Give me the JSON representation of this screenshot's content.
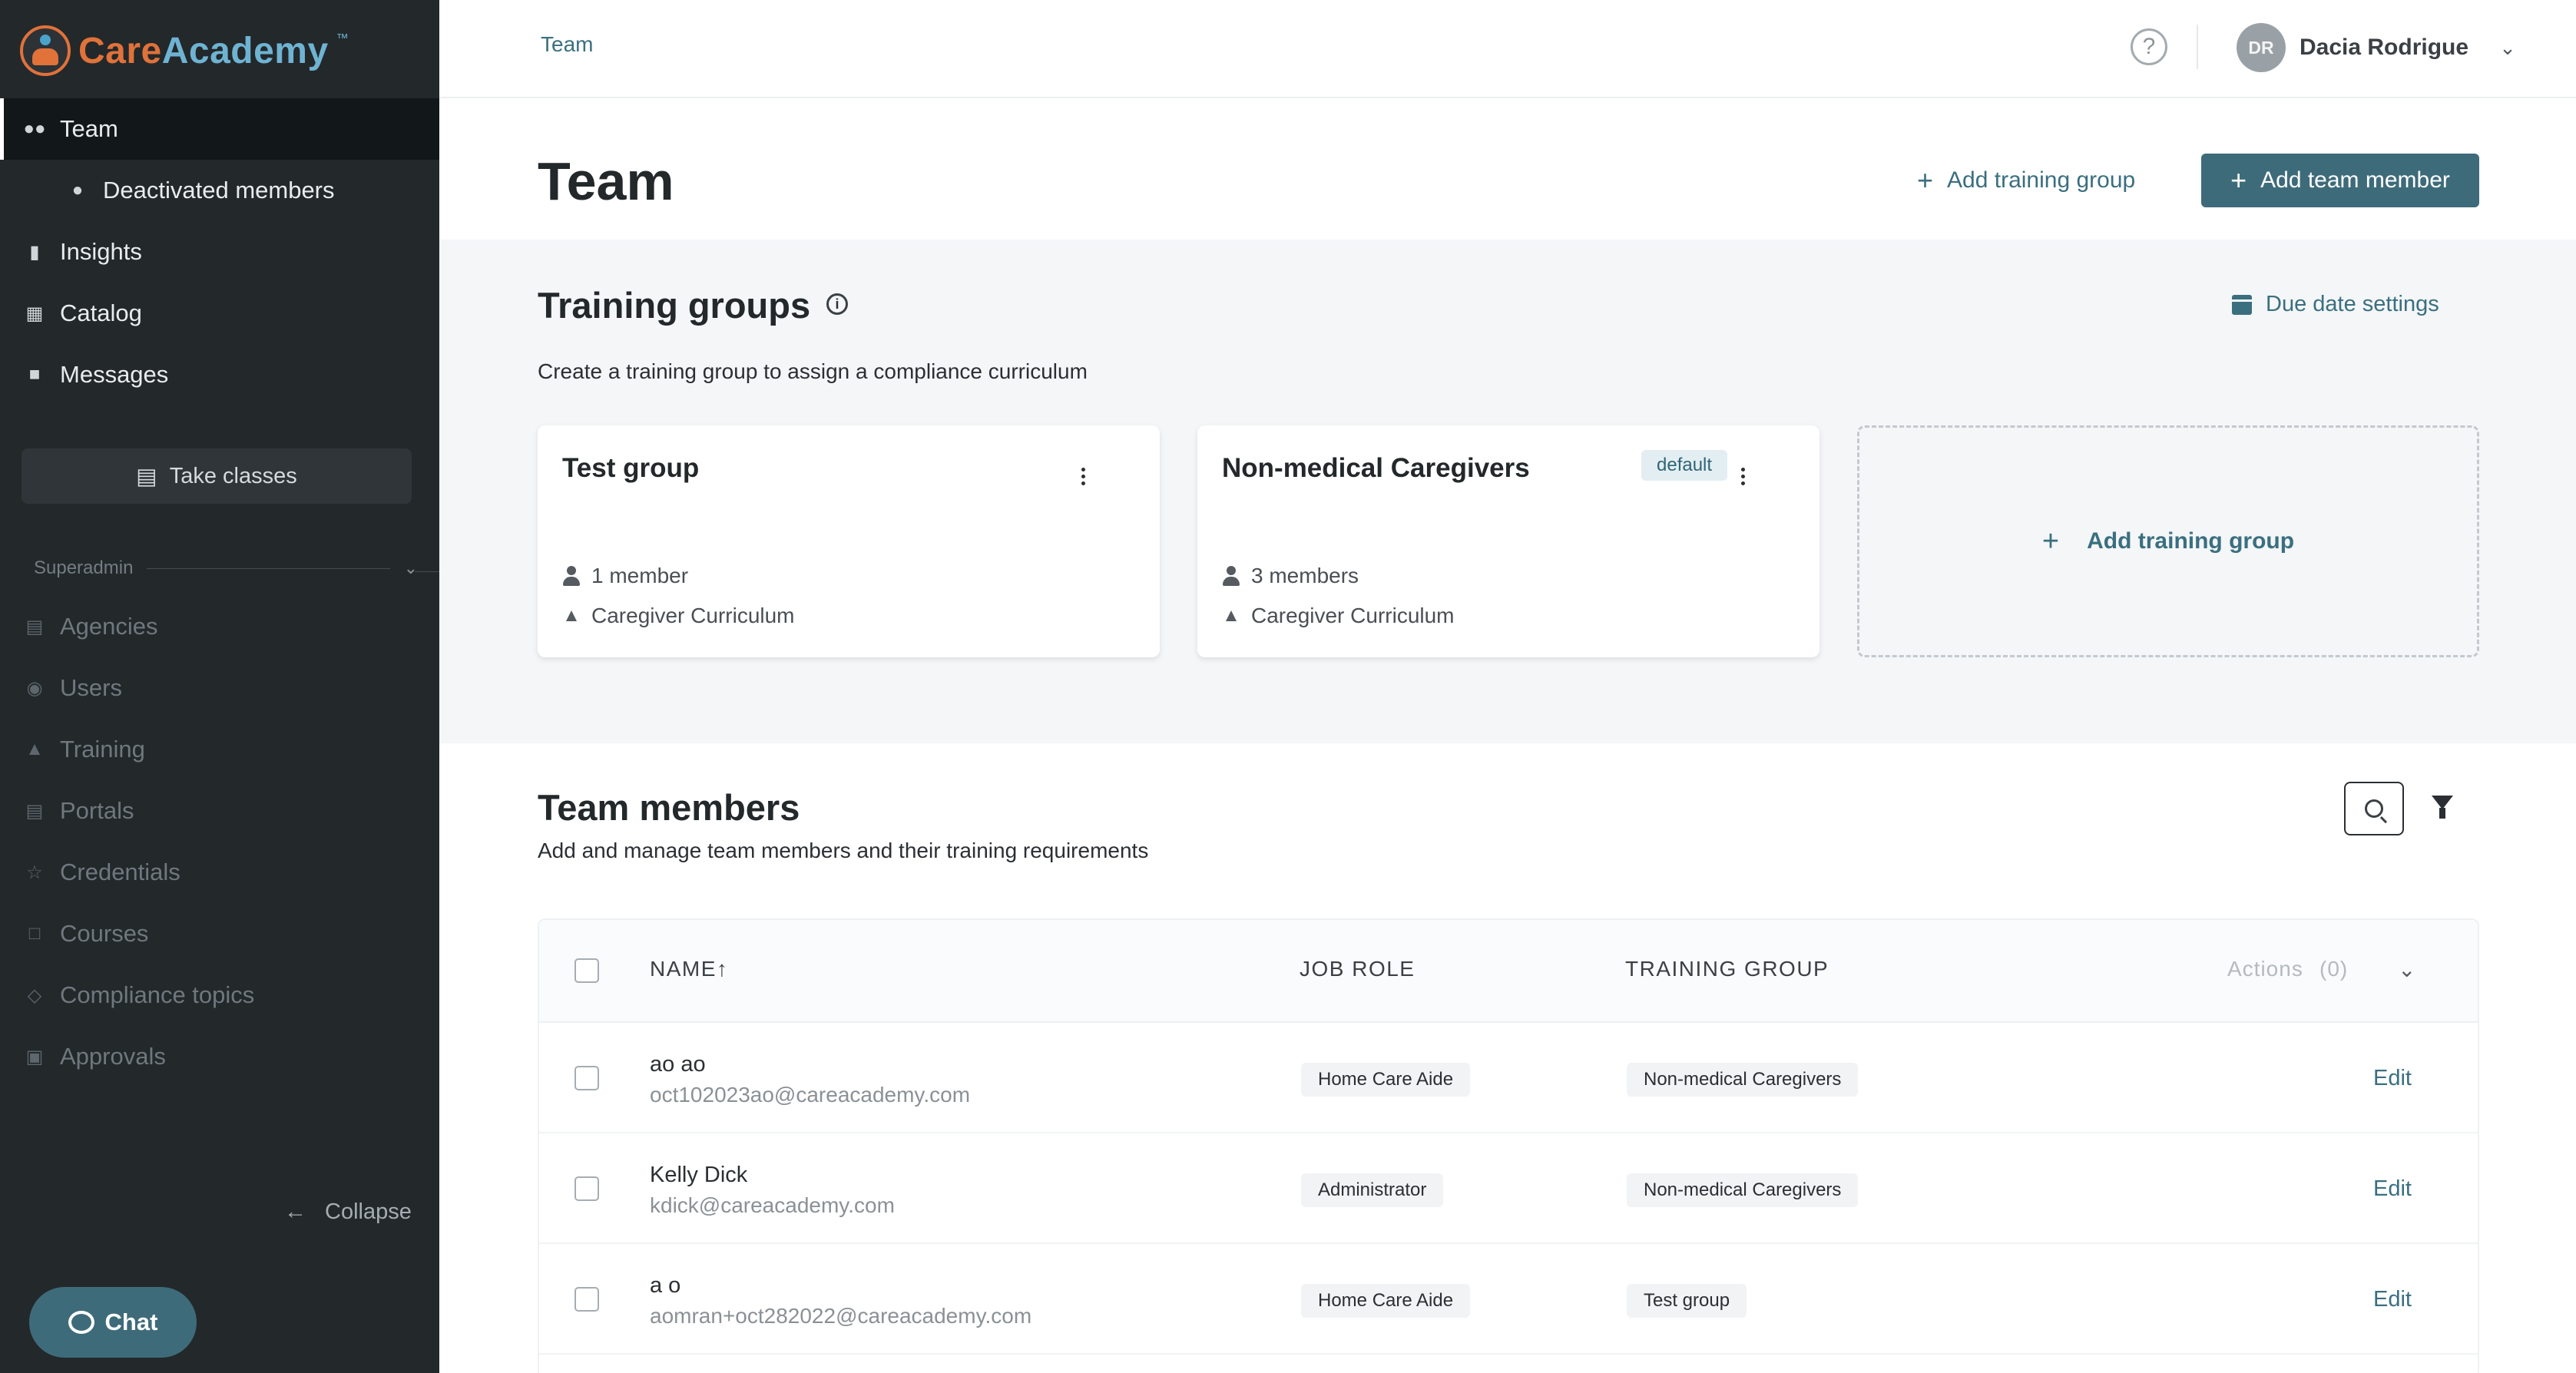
{
  "sidebar": {
    "logo": {
      "care": "Care",
      "academy": "Academy",
      "tm": "™"
    },
    "items": [
      {
        "label": "Team",
        "icon": "team-icon"
      },
      {
        "label": "Deactivated members",
        "icon": "person-icon"
      },
      {
        "label": "Insights",
        "icon": "bar-chart-icon"
      },
      {
        "label": "Catalog",
        "icon": "book-icon"
      },
      {
        "label": "Messages",
        "icon": "chat-bubble-icon"
      }
    ],
    "take_classes": "Take classes",
    "superadmin_label": "Superadmin",
    "admin_items": [
      {
        "label": "Agencies",
        "icon": "building-icon"
      },
      {
        "label": "Users",
        "icon": "users-icon"
      },
      {
        "label": "Training",
        "icon": "graduation-cap-icon"
      },
      {
        "label": "Portals",
        "icon": "portal-icon"
      },
      {
        "label": "Credentials",
        "icon": "star-icon"
      },
      {
        "label": "Courses",
        "icon": "open-book-icon"
      },
      {
        "label": "Compliance topics",
        "icon": "tag-icon"
      },
      {
        "label": "Approvals",
        "icon": "clipboard-check-icon"
      }
    ],
    "collapse": "Collapse",
    "chat": "Chat"
  },
  "topbar": {
    "breadcrumb": "Team",
    "user": {
      "initials": "DR",
      "name": "Dacia Rodrigue"
    }
  },
  "header": {
    "title": "Team",
    "add_training_group": "Add training group",
    "add_team_member": "Add team member"
  },
  "training_groups": {
    "title": "Training groups",
    "due_date_settings": "Due date settings",
    "subtitle": "Create a training group to assign a compliance curriculum",
    "cards": [
      {
        "name": "Test group",
        "members": "1 member",
        "curriculum": "Caregiver Curriculum",
        "badge": ""
      },
      {
        "name": "Non-medical Caregivers",
        "members": "3 members",
        "curriculum": "Caregiver Curriculum",
        "badge": "default"
      }
    ],
    "add_card_label": "Add training group"
  },
  "team_members": {
    "title": "Team members",
    "subtitle": "Add and manage team members and their training requirements",
    "columns": {
      "name": "NAME↑",
      "job_role": "JOB ROLE",
      "training_group": "TRAINING GROUP",
      "actions": "Actions",
      "actions_count": "(0)"
    },
    "rows": [
      {
        "name": "ao ao",
        "email": "oct102023ao@careacademy.com",
        "job_role": "Home Care Aide",
        "training_group": "Non-medical Caregivers",
        "action": "Edit"
      },
      {
        "name": "Kelly Dick",
        "email": "kdick@careacademy.com",
        "job_role": "Administrator",
        "training_group": "Non-medical Caregivers",
        "action": "Edit"
      },
      {
        "name": "a o",
        "email": "aomran+oct282022@careacademy.com",
        "job_role": "Home Care Aide",
        "training_group": "Test group",
        "action": "Edit"
      }
    ]
  },
  "colors": {
    "sidebar_bg": "#23282b",
    "accent": "#3e6b7a",
    "link": "#3a6f80",
    "logo_orange": "#e0723a",
    "logo_blue": "#6fb3d2"
  }
}
